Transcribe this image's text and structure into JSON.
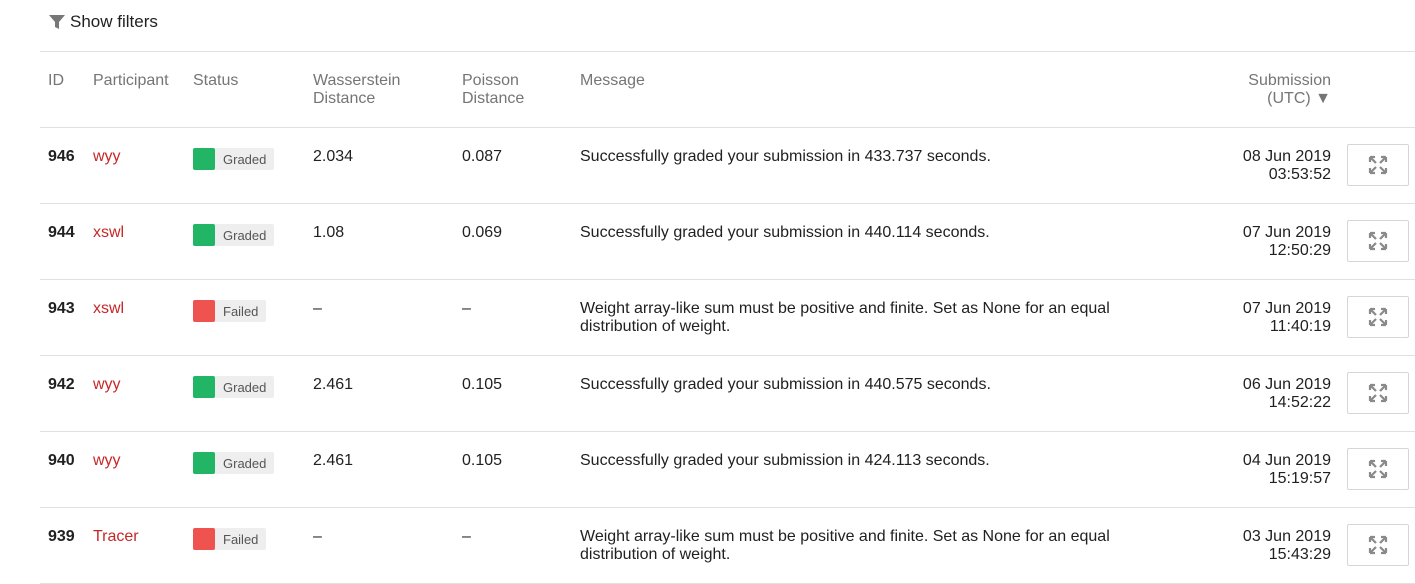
{
  "filters": {
    "label": "Show filters",
    "icon": "filter-icon"
  },
  "columns": {
    "id": "ID",
    "participant": "Participant",
    "status": "Status",
    "wasserstein": [
      "Wasserstein",
      "Distance"
    ],
    "poisson": [
      "Poisson",
      "Distance"
    ],
    "message": "Message",
    "submission": [
      "Submission",
      "(UTC) ▼"
    ]
  },
  "colors": {
    "graded": "#22b566",
    "failed": "#ef5350",
    "participant": "#c62828"
  },
  "rows": [
    {
      "id": "946",
      "participant": "wyy",
      "status": "Graded",
      "status_color": "#22b566",
      "wasserstein": "2.034",
      "poisson": "0.087",
      "message": [
        "Successfully graded your submission in 433.737 seconds.",
        ""
      ],
      "date": "08 Jun 2019",
      "time": "03:53:52"
    },
    {
      "id": "944",
      "participant": "xswl",
      "status": "Graded",
      "status_color": "#22b566",
      "wasserstein": "1.08",
      "poisson": "0.069",
      "message": [
        "Successfully graded your submission in 440.114 seconds.",
        ""
      ],
      "date": "07 Jun 2019",
      "time": "12:50:29"
    },
    {
      "id": "943",
      "participant": "xswl",
      "status": "Failed",
      "status_color": "#ef5350",
      "wasserstein": "–",
      "poisson": "–",
      "message": [
        "Weight array-like sum must be positive and finite. Set as None for an equal",
        "distribution of weight."
      ],
      "date": "07 Jun 2019",
      "time": "11:40:19"
    },
    {
      "id": "942",
      "participant": "wyy",
      "status": "Graded",
      "status_color": "#22b566",
      "wasserstein": "2.461",
      "poisson": "0.105",
      "message": [
        "Successfully graded your submission in 440.575 seconds.",
        ""
      ],
      "date": "06 Jun 2019",
      "time": "14:52:22"
    },
    {
      "id": "940",
      "participant": "wyy",
      "status": "Graded",
      "status_color": "#22b566",
      "wasserstein": "2.461",
      "poisson": "0.105",
      "message": [
        "Successfully graded your submission in 424.113 seconds.",
        ""
      ],
      "date": "04 Jun 2019",
      "time": "15:19:57"
    },
    {
      "id": "939",
      "participant": "Tracer",
      "status": "Failed",
      "status_color": "#ef5350",
      "wasserstein": "–",
      "poisson": "–",
      "message": [
        "Weight array-like sum must be positive and finite. Set as None for an equal",
        "distribution of weight."
      ],
      "date": "03 Jun 2019",
      "time": "15:43:29"
    }
  ],
  "row_action_icon": "expand-icon"
}
